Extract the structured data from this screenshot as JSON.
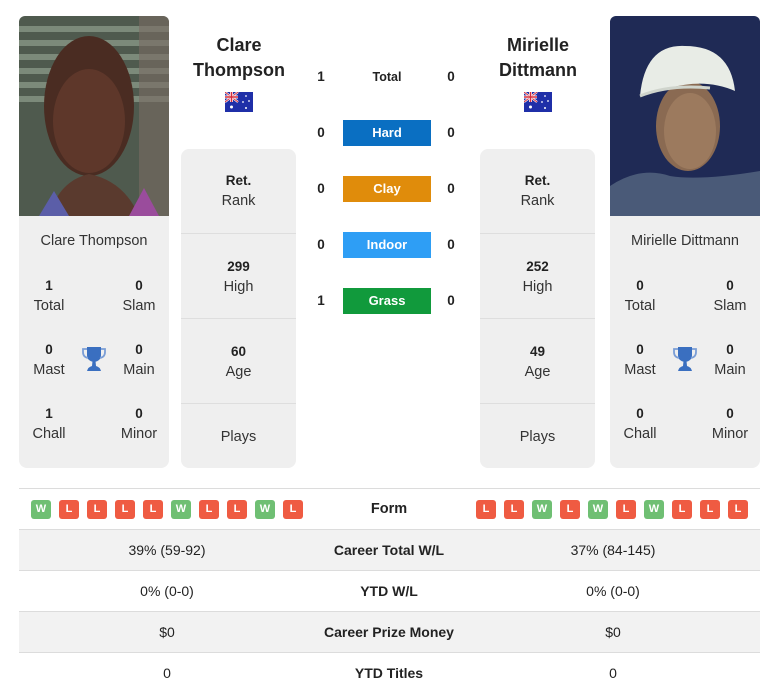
{
  "player1": {
    "name": "Clare Thompson",
    "name_line1": "Clare",
    "name_line2": "Thompson",
    "country_flag": "australia-flag",
    "photo_alt": "Clare Thompson photo",
    "titles": {
      "total": {
        "value": "1",
        "label": "Total"
      },
      "slam": {
        "value": "0",
        "label": "Slam"
      },
      "mast": {
        "value": "0",
        "label": "Mast"
      },
      "main": {
        "value": "0",
        "label": "Main"
      },
      "chall": {
        "value": "1",
        "label": "Chall"
      },
      "minor": {
        "value": "0",
        "label": "Minor"
      }
    },
    "rank": {
      "value": "Ret.",
      "label": "Rank"
    },
    "high": {
      "value": "299",
      "label": "High"
    },
    "age": {
      "value": "60",
      "label": "Age"
    },
    "plays": {
      "value": "",
      "label": "Plays"
    },
    "form": [
      "W",
      "L",
      "L",
      "L",
      "L",
      "W",
      "L",
      "L",
      "W",
      "L"
    ]
  },
  "player2": {
    "name": "Mirielle Dittmann",
    "name_line1": "Mirielle",
    "name_line2": "Dittmann",
    "country_flag": "australia-flag",
    "photo_alt": "Mirielle Dittmann photo",
    "titles": {
      "total": {
        "value": "0",
        "label": "Total"
      },
      "slam": {
        "value": "0",
        "label": "Slam"
      },
      "mast": {
        "value": "0",
        "label": "Mast"
      },
      "main": {
        "value": "0",
        "label": "Main"
      },
      "chall": {
        "value": "0",
        "label": "Chall"
      },
      "minor": {
        "value": "0",
        "label": "Minor"
      }
    },
    "rank": {
      "value": "Ret.",
      "label": "Rank"
    },
    "high": {
      "value": "252",
      "label": "High"
    },
    "age": {
      "value": "49",
      "label": "Age"
    },
    "plays": {
      "value": "",
      "label": "Plays"
    },
    "form": [
      "L",
      "L",
      "W",
      "L",
      "W",
      "L",
      "W",
      "L",
      "L",
      "L"
    ]
  },
  "h2h": [
    {
      "surface": "Total",
      "p1": "1",
      "p2": "0",
      "color": ""
    },
    {
      "surface": "Hard",
      "p1": "0",
      "p2": "0",
      "color": "#0a6fc2"
    },
    {
      "surface": "Clay",
      "p1": "0",
      "p2": "0",
      "color": "#e08c0b"
    },
    {
      "surface": "Indoor",
      "p1": "0",
      "p2": "0",
      "color": "#2e9ef5"
    },
    {
      "surface": "Grass",
      "p1": "1",
      "p2": "0",
      "color": "#119a3c"
    }
  ],
  "form_label": "Form",
  "stats": [
    {
      "label": "Career Total W/L",
      "p1": "39% (59-92)",
      "p2": "37% (84-145)"
    },
    {
      "label": "YTD W/L",
      "p1": "0% (0-0)",
      "p2": "0% (0-0)"
    },
    {
      "label": "Career Prize Money",
      "p1": "$0",
      "p2": "$0"
    },
    {
      "label": "YTD Titles",
      "p1": "0",
      "p2": "0"
    }
  ],
  "colors": {
    "win": "#6fbf73",
    "loss": "#ef5b42",
    "trophy": "#3a6fc0",
    "card_bg": "#efefef"
  }
}
